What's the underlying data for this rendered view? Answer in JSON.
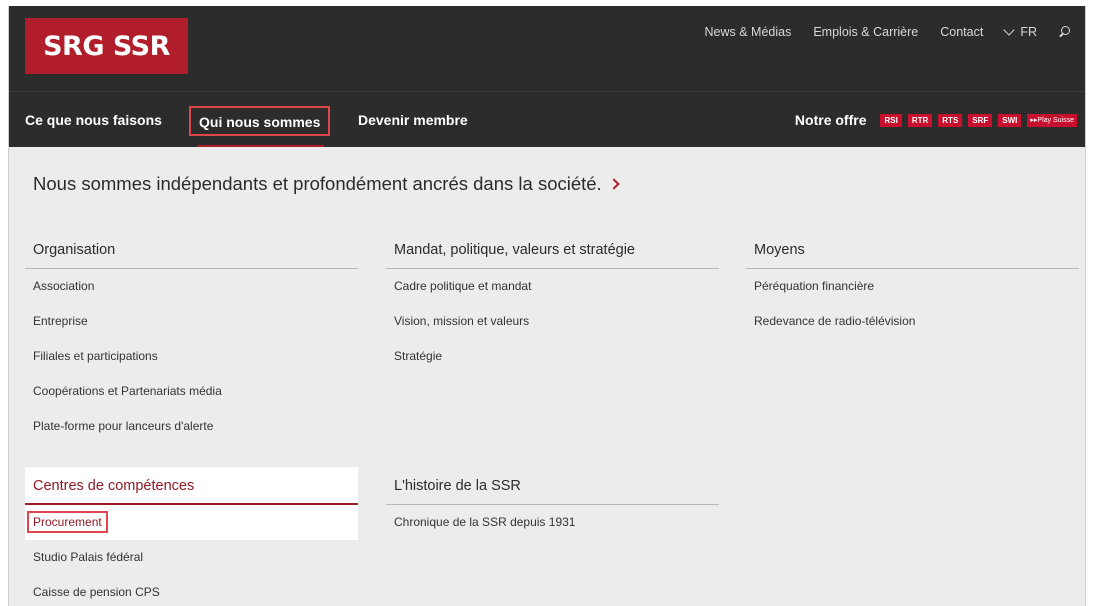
{
  "header": {
    "logo_text": "SRG SSR",
    "links": [
      "News & Médias",
      "Emplois & Carrière",
      "Contact"
    ],
    "language": "FR",
    "icons": {
      "language": "chevron-down-icon",
      "search": "search-icon"
    }
  },
  "nav": {
    "items": [
      "Ce que nous faisons",
      "Qui nous sommes",
      "Devenir membre"
    ],
    "active": "Qui nous sommes",
    "offer_label": "Notre offre",
    "units": [
      "RSI",
      "RTR",
      "RTS",
      "SRF",
      "SWI",
      "▸▸Play Suisse"
    ]
  },
  "colors": {
    "brand_red": "#b21d2c",
    "unit_red": "#c8102e",
    "dark_bg": "#2c2c2c",
    "panel_bg": "#ececec",
    "highlight_box": "#e0444c"
  },
  "menu": {
    "headline": "Nous sommes indépendants et profondément ancrés dans la société.",
    "columns": [
      {
        "title": "Organisation",
        "links": [
          "Association",
          "Entreprise",
          "Filiales et participations",
          "Coopérations et Partenariats média",
          "Plate-forme pour lanceurs d'alerte"
        ]
      },
      {
        "title": "Mandat, politique, valeurs et stratégie",
        "links": [
          "Cadre politique et mandat",
          "Vision, mission et valeurs",
          "Stratégie"
        ]
      },
      {
        "title": "Moyens",
        "links": [
          "Péréquation financière",
          "Redevance de radio-télévision"
        ]
      },
      {
        "title": "Centres de compétences",
        "links": [
          "Procurement",
          "Studio Palais fédéral",
          "Caisse de pension CPS"
        ]
      },
      {
        "title": "L'histoire de la SSR",
        "links": [
          "Chronique de la SSR depuis 1931"
        ]
      }
    ]
  }
}
